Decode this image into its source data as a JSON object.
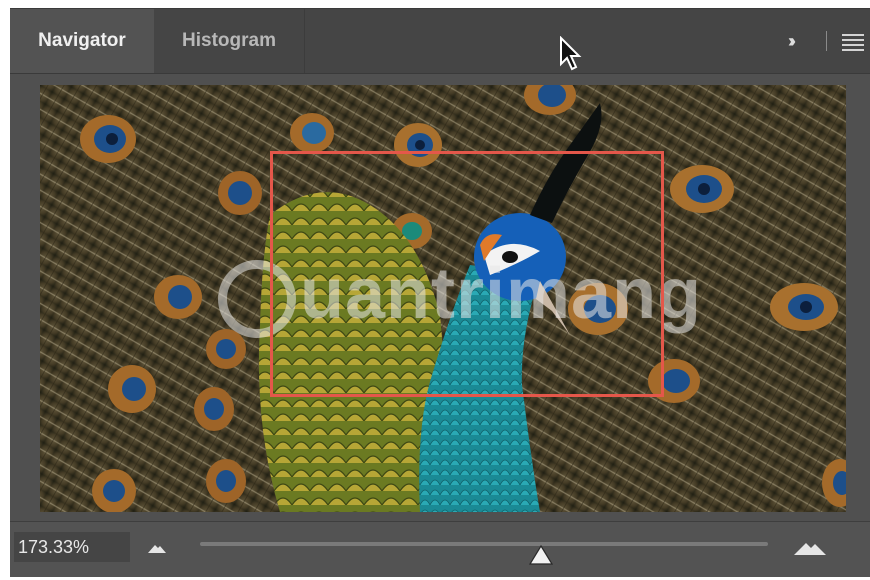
{
  "tabs": [
    {
      "label": "Navigator",
      "active": true
    },
    {
      "label": "Histogram",
      "active": false
    }
  ],
  "header": {
    "expand_icon": "double-chevron-right-icon",
    "menu_icon": "hamburger-menu-icon"
  },
  "preview": {
    "image": "peacock-photo",
    "watermark": "uantrimang",
    "view_rect_color": "#e4574a"
  },
  "zoom": {
    "value_text": "173.33%",
    "slider_fraction": 0.6,
    "zoom_out_icon": "small-mountain-icon",
    "zoom_in_icon": "large-mountain-icon"
  },
  "colors": {
    "panel": "#505050",
    "tabbar": "#454545",
    "active_tab": "#535353"
  }
}
